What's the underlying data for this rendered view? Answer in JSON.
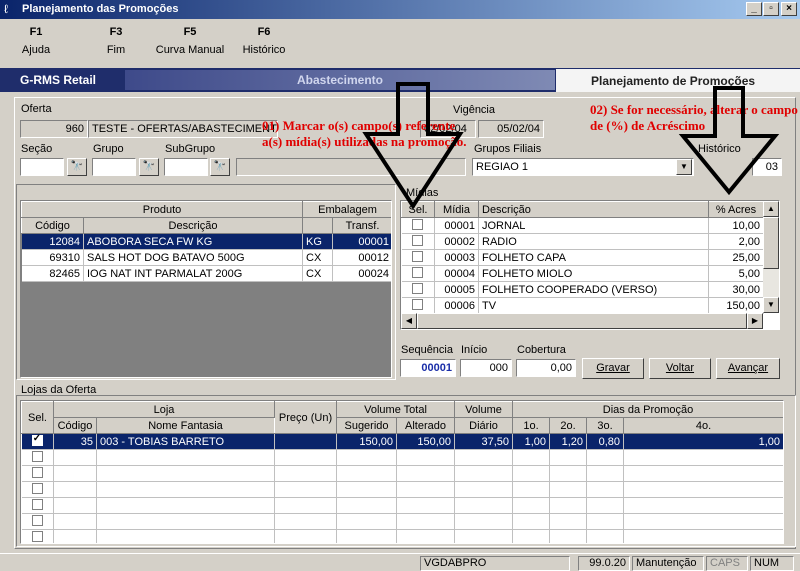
{
  "window": {
    "title": "Planejamento das Promoções"
  },
  "fkeys": [
    {
      "key": "F1",
      "label": "Ajuda"
    },
    {
      "key": "F3",
      "label": "Fim"
    },
    {
      "key": "F5",
      "label": "Curva Manual"
    },
    {
      "key": "F6",
      "label": "Histórico"
    }
  ],
  "ribbon": {
    "left": "G-RMS Retail",
    "mid": "Abastecimento",
    "right": "Planejamento de Promoções"
  },
  "oferta": {
    "label": "Oferta",
    "code": "960",
    "desc": "TESTE - OFERTAS/ABASTECIMENTO"
  },
  "vigencia": {
    "label": "Vigência",
    "start": "02/02/04",
    "end": "05/02/04"
  },
  "filters": {
    "secao": "Seção",
    "grupo": "Grupo",
    "subgrupo": "SubGrupo",
    "grupos_filiais_label": "Grupos Filiais",
    "grupos_filiais_value": "REGIAO 1",
    "historico_label": "Histórico",
    "historico_value": "03"
  },
  "products": {
    "headers": {
      "produto": "Produto",
      "embalagem": "Embalagem",
      "codigo": "Código",
      "descricao": "Descrição",
      "transf": "Transf."
    },
    "rows": [
      {
        "codigo": "12084",
        "descricao": "ABOBORA SECA FW KG",
        "emb": "KG",
        "transf": "00001"
      },
      {
        "codigo": "69310",
        "descricao": "SALS HOT DOG BATAVO 500G",
        "emb": "CX",
        "transf": "00012"
      },
      {
        "codigo": "82465",
        "descricao": "IOG NAT INT PARMALAT 200G",
        "emb": "CX",
        "transf": "00024"
      }
    ]
  },
  "midias": {
    "label": "Mídias",
    "headers": {
      "sel": "Sel.",
      "midia": "Mídia",
      "descricao": "Descrição",
      "acres": "% Acres"
    },
    "rows": [
      {
        "midia": "00001",
        "descricao": "JORNAL",
        "acres": "10,00"
      },
      {
        "midia": "00002",
        "descricao": "RADIO",
        "acres": "2,00"
      },
      {
        "midia": "00003",
        "descricao": "FOLHETO CAPA",
        "acres": "25,00"
      },
      {
        "midia": "00004",
        "descricao": "FOLHETO MIOLO",
        "acres": "5,00"
      },
      {
        "midia": "00005",
        "descricao": "FOLHETO COOPERADO (VERSO)",
        "acres": "30,00"
      },
      {
        "midia": "00006",
        "descricao": "TV",
        "acres": "150,00"
      }
    ]
  },
  "sequencia": {
    "label": "Sequência",
    "value": "00001",
    "inicio_label": "Início",
    "inicio": "000",
    "cobertura_label": "Cobertura",
    "cobertura": "0,00"
  },
  "buttons": {
    "gravar": "Gravar",
    "voltar": "Voltar",
    "avancar": "Avançar"
  },
  "lojas": {
    "label": "Lojas da Oferta",
    "headers": {
      "sel": "Sel.",
      "loja": "Loja",
      "codigo": "Código",
      "nome": "Nome Fantasia",
      "preco": "Preço (Un)",
      "vol_total": "Volume Total",
      "sugerido": "Sugerido",
      "alterado": "Alterado",
      "volume": "Volume",
      "diario": "Diário",
      "dias": "Dias da Promoção",
      "d1": "1o.",
      "d2": "2o.",
      "d3": "3o.",
      "d4": "4o."
    },
    "rows": [
      {
        "codigo": "35",
        "nome": "003 - TOBIAS BARRETO",
        "preco": "",
        "sugerido": "150,00",
        "alterado": "150,00",
        "diario": "37,50",
        "d1": "1,00",
        "d2": "1,20",
        "d3": "0,80",
        "d4": "1,00"
      }
    ]
  },
  "annotations": {
    "a1": "01) Marcar o(s) campo(s) referente a(s) mídia(s) utilizadas na promoção.",
    "a2": "02) Se for necessário, alterar o campo de (%) de Acréscimo"
  },
  "status": {
    "user": "VGDABPRO",
    "version": "99.0.20",
    "mode": "Manutenção",
    "caps": "CAPS",
    "num": "NUM"
  }
}
